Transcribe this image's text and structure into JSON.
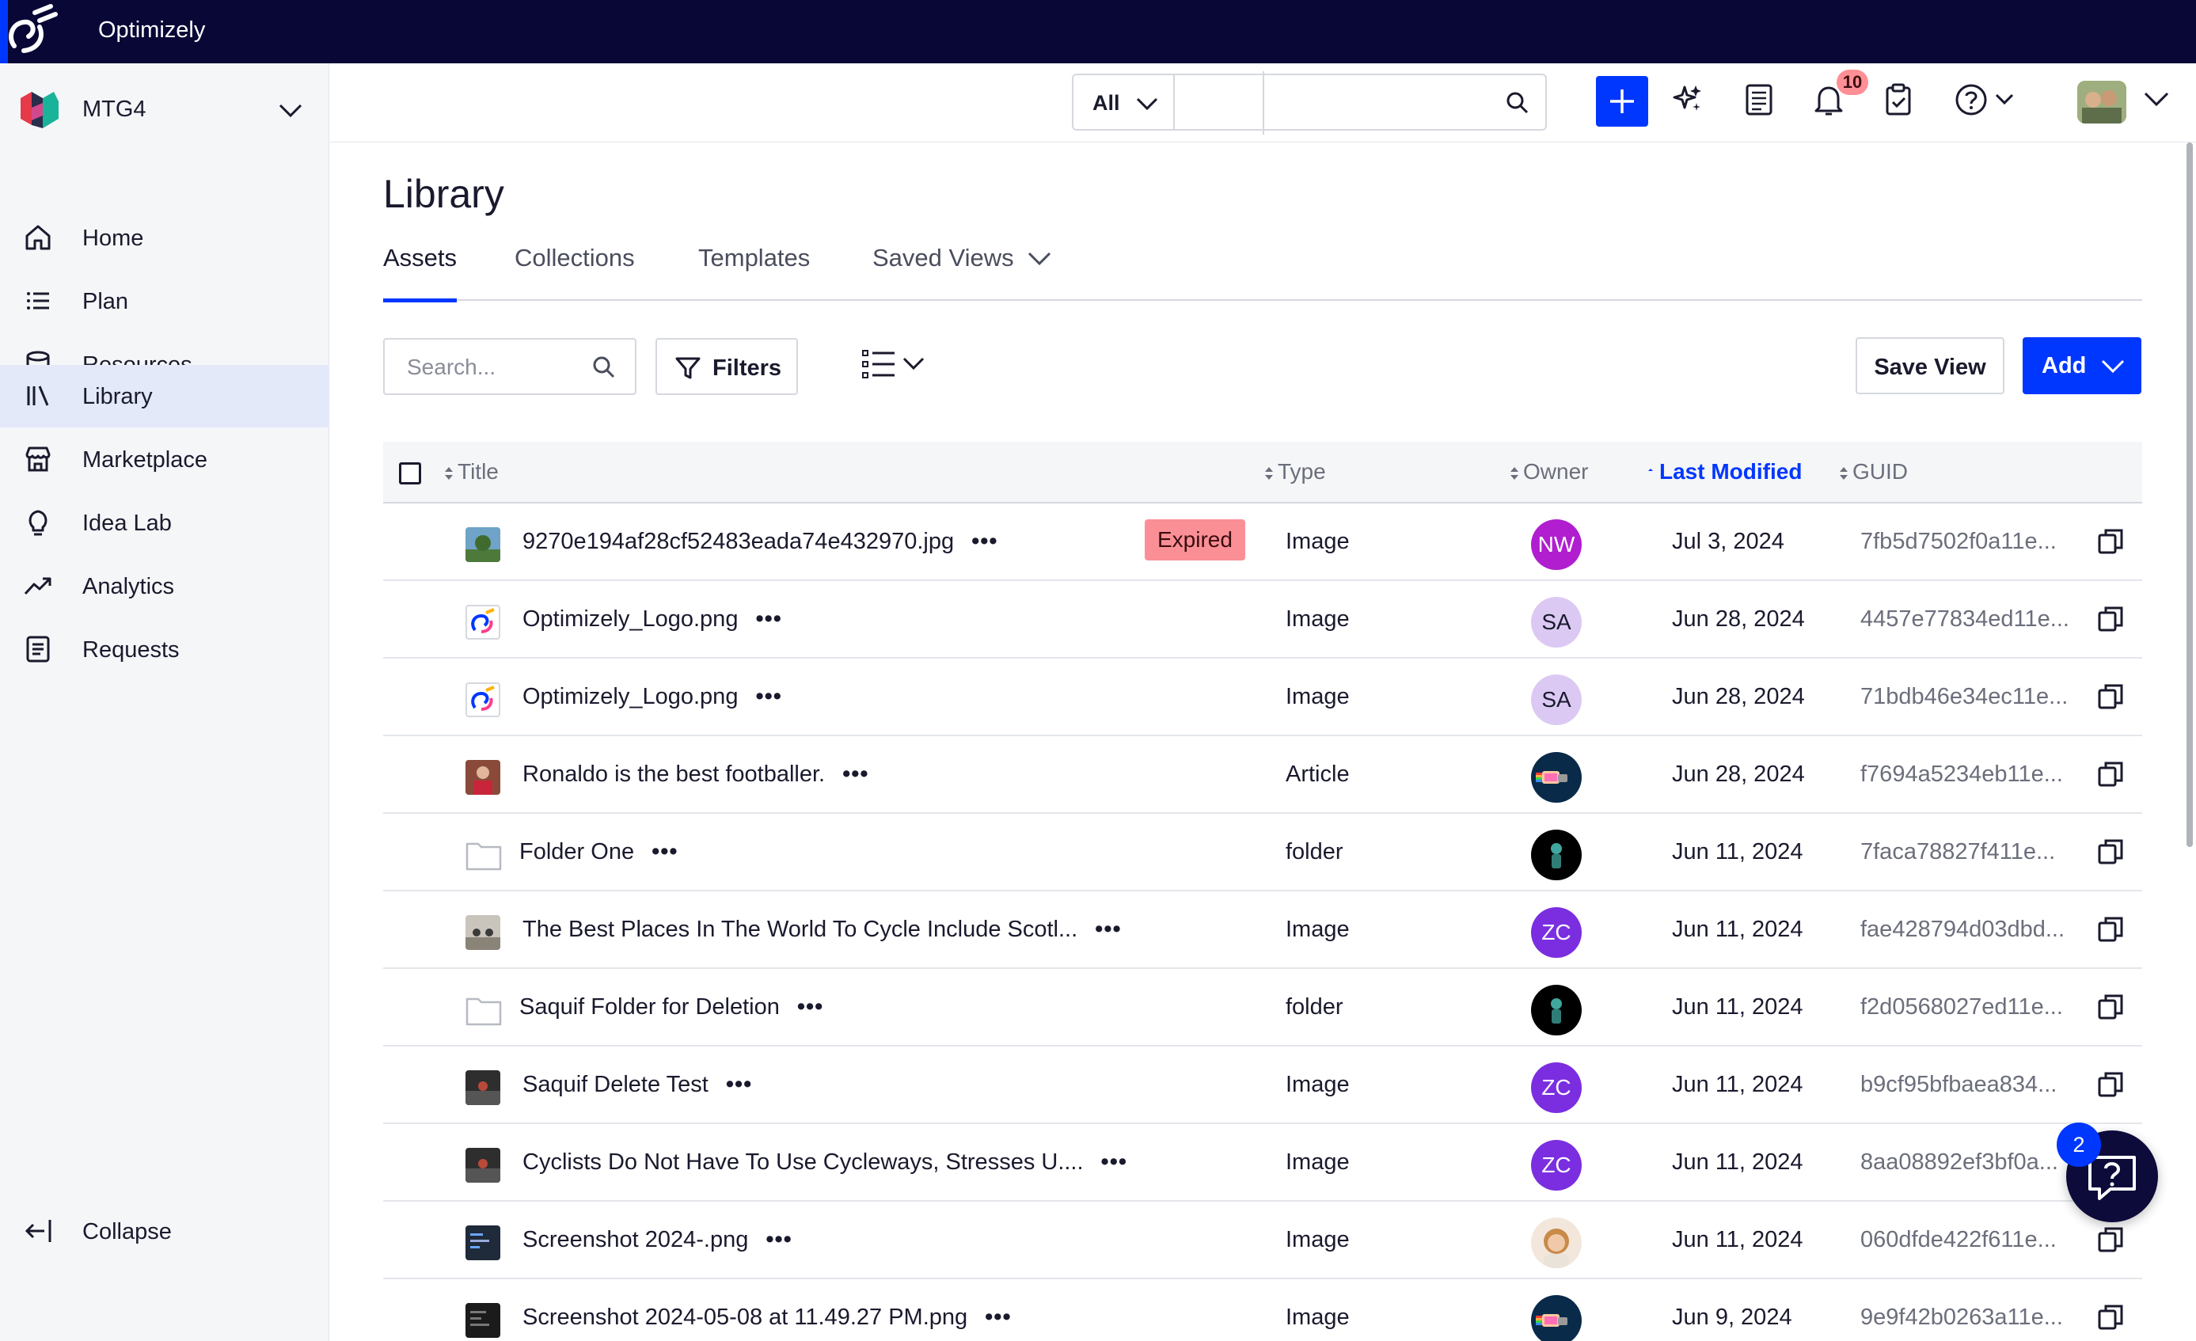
{
  "brand": {
    "name": "Optimizely"
  },
  "workspace": {
    "name": "MTG4"
  },
  "sidebar": {
    "items": [
      {
        "label": "Home",
        "icon": "home-icon"
      },
      {
        "label": "Plan",
        "icon": "list-icon"
      },
      {
        "label": "Resources",
        "icon": "database-icon"
      },
      {
        "label": "Library",
        "icon": "library-icon",
        "active": true
      },
      {
        "label": "Marketplace",
        "icon": "store-icon"
      },
      {
        "label": "Idea Lab",
        "icon": "lightbulb-icon"
      },
      {
        "label": "Analytics",
        "icon": "trend-icon"
      },
      {
        "label": "Requests",
        "icon": "document-icon"
      }
    ],
    "collapse_label": "Collapse"
  },
  "header": {
    "scope_value": "All",
    "search_value": "",
    "notifications_count": "10"
  },
  "page": {
    "title": "Library",
    "tabs": [
      "Assets",
      "Collections",
      "Templates",
      "Saved Views"
    ],
    "active_tab": "Assets"
  },
  "toolbar": {
    "search_placeholder": "Search...",
    "filters_label": "Filters",
    "save_view_label": "Save View",
    "add_label": "Add"
  },
  "table": {
    "columns": {
      "title": "Title",
      "type": "Type",
      "owner": "Owner",
      "last_modified": "Last Modified",
      "guid": "GUID"
    },
    "sorted_column": "Last Modified",
    "rows": [
      {
        "title": "9270e194af28cf52483eada74e432970.jpg",
        "badge": "Expired",
        "type": "Image",
        "owner": "NW",
        "date": "Jul 3, 2024",
        "guid": "7fb5d7502f0a11e..."
      },
      {
        "title": "Optimizely_Logo.png",
        "type": "Image",
        "owner": "SA",
        "date": "Jun 28, 2024",
        "guid": "4457e77834ed11e..."
      },
      {
        "title": "Optimizely_Logo.png",
        "type": "Image",
        "owner": "SA",
        "date": "Jun 28, 2024",
        "guid": "71bdb46e34ec11e..."
      },
      {
        "title": "Ronaldo is the best footballer.",
        "type": "Article",
        "owner": "",
        "date": "Jun 28, 2024",
        "guid": "f7694a5234eb11e..."
      },
      {
        "title": "Folder One",
        "type": "folder",
        "owner": "",
        "date": "Jun 11, 2024",
        "guid": "7faca78827f411e..."
      },
      {
        "title": "The Best Places In The World To Cycle Include Scotl...",
        "type": "Image",
        "owner": "ZC",
        "date": "Jun 11, 2024",
        "guid": "fae428794d03dbd..."
      },
      {
        "title": "Saquif Folder for Deletion",
        "type": "folder",
        "owner": "",
        "date": "Jun 11, 2024",
        "guid": "f2d0568027ed11e..."
      },
      {
        "title": "Saquif Delete Test",
        "type": "Image",
        "owner": "ZC",
        "date": "Jun 11, 2024",
        "guid": "b9cf95bfbaea834..."
      },
      {
        "title": "Cyclists Do Not Have To Use Cycleways, Stresses U....",
        "type": "Image",
        "owner": "ZC",
        "date": "Jun 11, 2024",
        "guid": "8aa08892ef3bf0a..."
      },
      {
        "title": "Screenshot 2024-.png",
        "type": "Image",
        "owner": "",
        "date": "Jun 11, 2024",
        "guid": "060dfde422f611e..."
      },
      {
        "title": "Screenshot 2024-05-08 at 11.49.27 PM.png",
        "type": "Image",
        "owner": "",
        "date": "Jun 9, 2024",
        "guid": "9e9f42b0263a11e..."
      }
    ]
  },
  "help": {
    "badge_count": "2"
  },
  "colors": {
    "brand_bar": "#080736",
    "accent": "#0037ff",
    "expired_badge": "#fb8f96",
    "owner_nw": "#b01ecf",
    "owner_sa": "#dcc9f3",
    "owner_zc": "#7a2ee0"
  }
}
